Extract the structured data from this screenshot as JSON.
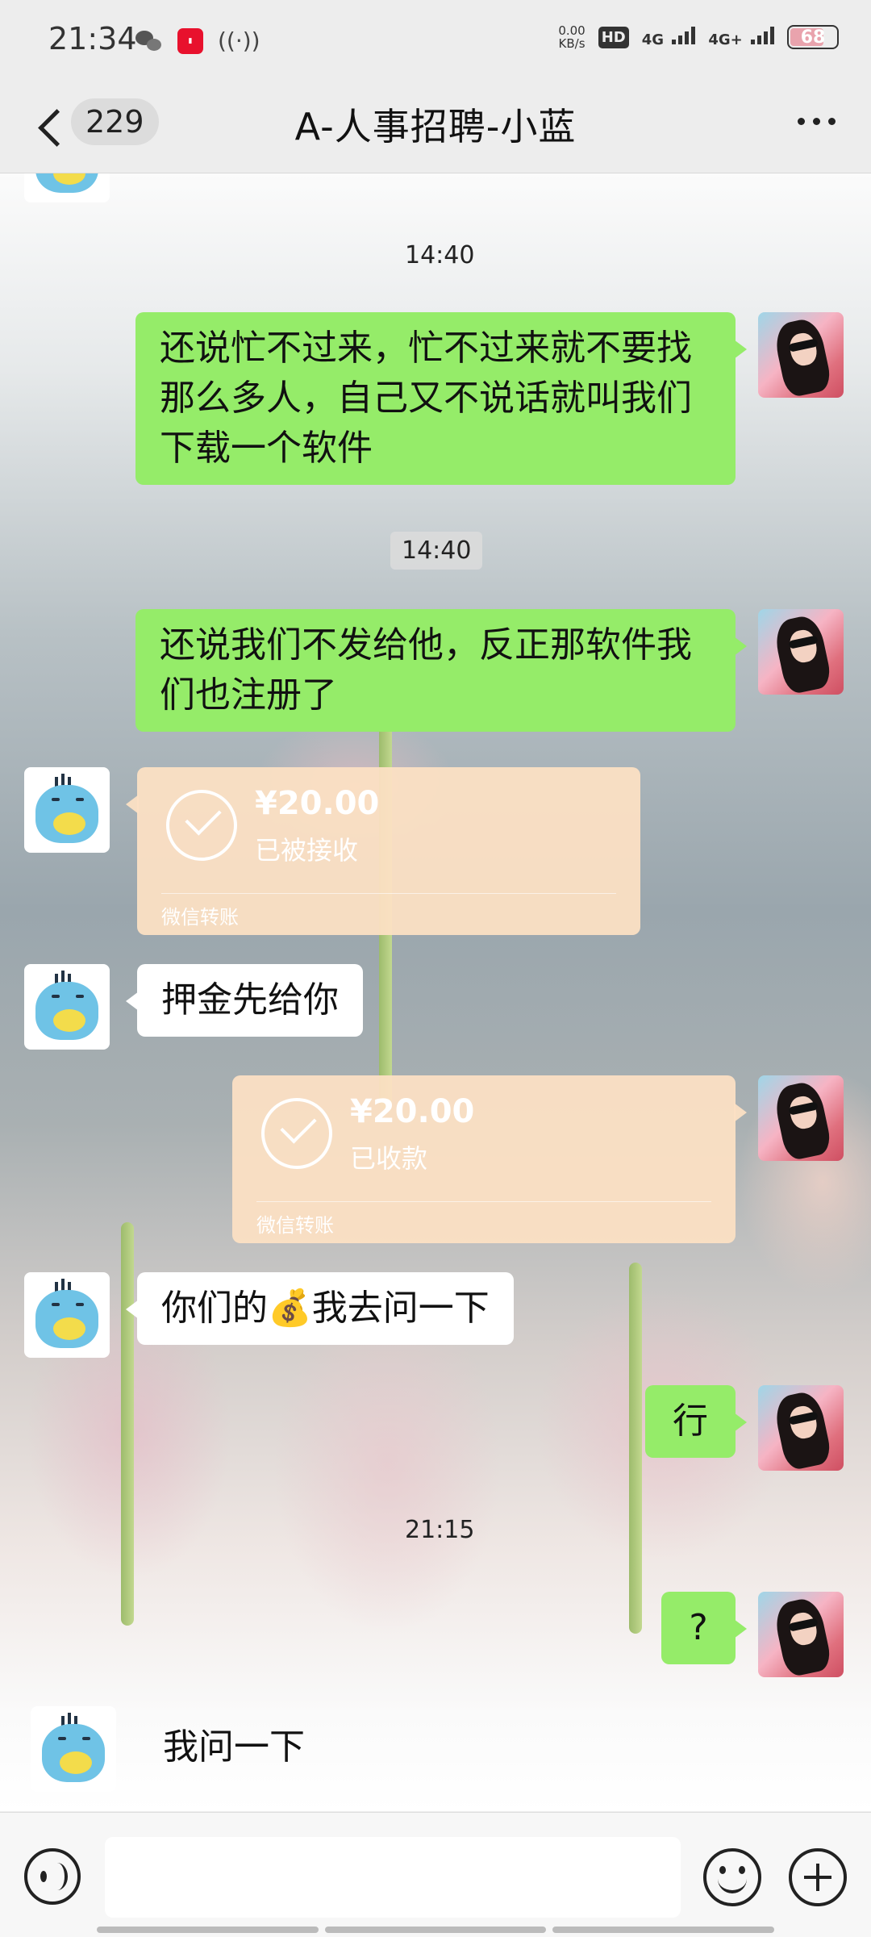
{
  "status_bar": {
    "time": "21:34",
    "speed_value": "0.00",
    "speed_unit": "KB/s",
    "hd_label": "HD",
    "sim1_label": "4G",
    "sim2_label": "4G+",
    "battery": "68",
    "icons": [
      "wechat-icon",
      "redbook-icon",
      "hotspot-icon",
      "signal-icon",
      "battery-icon"
    ]
  },
  "header": {
    "back_icon": "chevron-left-icon",
    "unread_count": "229",
    "title": "A-人事招聘-小蓝",
    "more_icon": "more-dots-icon"
  },
  "messages": [
    {
      "type": "time",
      "text": "14:40"
    },
    {
      "type": "text",
      "side": "right",
      "text": "还说忙不过来，忙不过来就不要找那么多人，自己又不说话就叫我们下载一个软件"
    },
    {
      "type": "time",
      "text": "14:40"
    },
    {
      "type": "text",
      "side": "right",
      "text": "还说我们不发给他，反正那软件我们也注册了"
    },
    {
      "type": "transfer",
      "side": "left",
      "amount": "¥20.00",
      "status": "已被接收",
      "footer": "微信转账"
    },
    {
      "type": "text",
      "side": "left",
      "text": "押金先给你"
    },
    {
      "type": "transfer",
      "side": "right",
      "amount": "¥20.00",
      "status": "已收款",
      "footer": "微信转账"
    },
    {
      "type": "text",
      "side": "left",
      "text_before": "你们的",
      "emoji": "💰",
      "text_after": "我去问一下"
    },
    {
      "type": "text",
      "side": "right",
      "text": "行"
    },
    {
      "type": "time",
      "text": "21:15"
    },
    {
      "type": "text",
      "side": "right",
      "text": "?"
    },
    {
      "type": "text",
      "side": "left",
      "text": "我问一下"
    }
  ],
  "input_bar": {
    "voice_icon": "voice-icon",
    "input_value": "",
    "emoji_icon": "emoji-icon",
    "plus_icon": "plus-icon"
  },
  "colors": {
    "sent_bubble": "#95ec69",
    "received_bubble": "#ffffff",
    "transfer_card": "#fce0c4",
    "header_bg": "#ededed"
  }
}
